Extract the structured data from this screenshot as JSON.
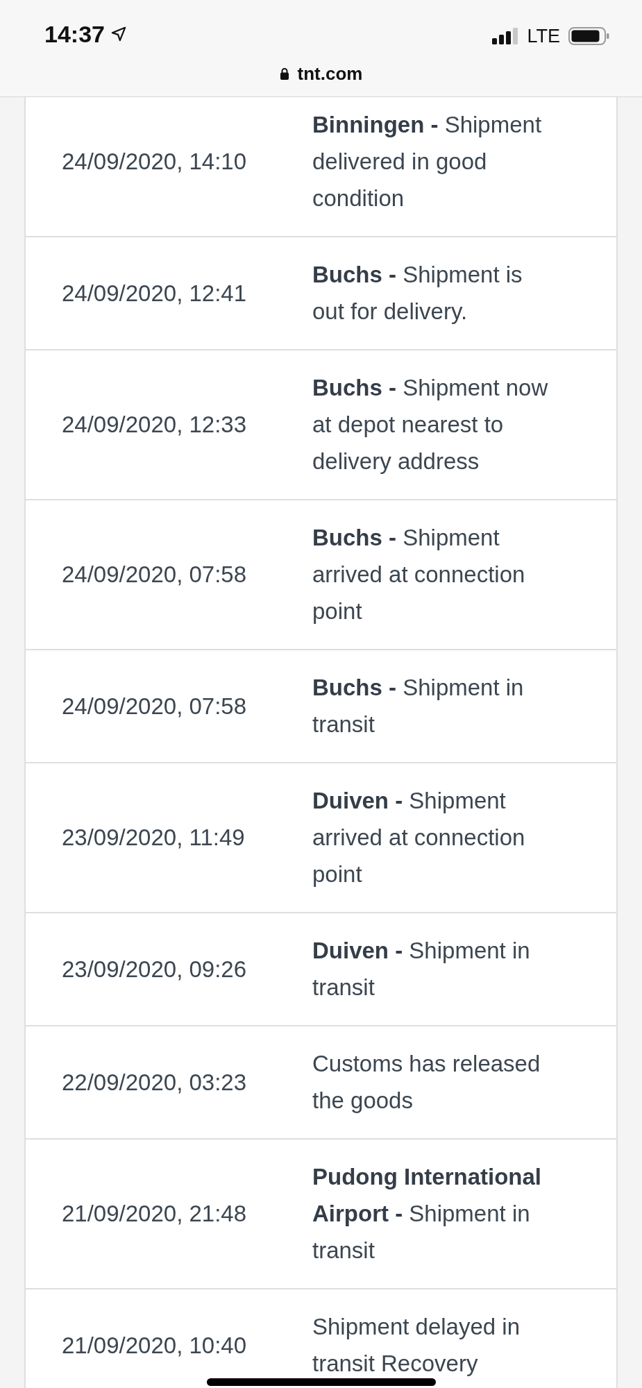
{
  "status_bar": {
    "time": "14:37",
    "network": "LTE"
  },
  "address_bar": {
    "url": "tnt.com"
  },
  "events": [
    {
      "date": "24/09/2020, 14:10",
      "status": "**Binningen -** Shipment delivered in good condition"
    },
    {
      "date": "24/09/2020, 12:41",
      "status": "**Buchs -** Shipment is out for delivery."
    },
    {
      "date": "24/09/2020, 12:33",
      "status": "**Buchs -** Shipment now at depot nearest to delivery address"
    },
    {
      "date": "24/09/2020, 07:58",
      "status": "**Buchs -** Shipment arrived at connection point"
    },
    {
      "date": "24/09/2020, 07:58",
      "status": "**Buchs -** Shipment in transit"
    },
    {
      "date": "23/09/2020, 11:49",
      "status": "**Duiven -** Shipment arrived at connection point"
    },
    {
      "date": "23/09/2020, 09:26",
      "status": "**Duiven -** Shipment in transit"
    },
    {
      "date": "22/09/2020, 03:23",
      "status": "Customs has released the goods"
    },
    {
      "date": "21/09/2020, 21:48",
      "status": "**Pudong International Airport -** Shipment in transit"
    },
    {
      "date": "21/09/2020, 10:40",
      "status": "Shipment delayed in transit Recovery"
    }
  ]
}
